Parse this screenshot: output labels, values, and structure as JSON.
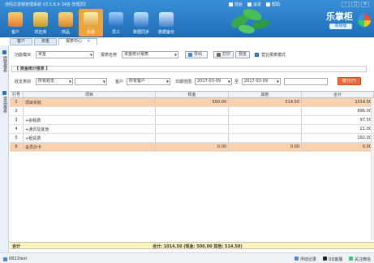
{
  "app": {
    "title": "佳码达进销管理系统 V2.5.8.9【4店-管理员】",
    "topbar": [
      "前台",
      "设定",
      "帮助"
    ],
    "brand": "乐掌柜",
    "brand_sub": "高级版"
  },
  "nav": [
    {
      "label": "客户"
    },
    {
      "label": "供应商"
    },
    {
      "label": "商品"
    },
    {
      "label": "资金"
    },
    {
      "label": "员工"
    },
    {
      "label": "数据同步"
    },
    {
      "label": "数据备份"
    }
  ],
  "tabs": [
    {
      "label": "客户"
    },
    {
      "label": "资金"
    },
    {
      "label": "报表中心",
      "active": true
    }
  ],
  "left_rail": [
    "经营报表",
    "常用报表"
  ],
  "form": {
    "module_label": "功能模块",
    "module_value": "资金",
    "report_label": "报表名称",
    "report_value": "资金统计报表",
    "export_label": "导出",
    "print_label": "打印",
    "preview_label": "预览",
    "business_mode_label": "营业报表模式",
    "section_title": "【 资金统计报表 】",
    "type_label": "收支类别",
    "type_value": "所有收支",
    "customer_label": "客户",
    "customer_value": "所有客户",
    "date_label": "日期范围",
    "date_from": "2017-03-09",
    "date_sep": "至",
    "date_to": "2017-03-09",
    "count_button": "统计(F)"
  },
  "table": {
    "headers": [
      "行号",
      "项目",
      "现金",
      "其他",
      "合计"
    ],
    "rows": [
      {
        "no": "1",
        "project": "项目实收",
        "cash": "500.00",
        "other": "514.50",
        "total": "1014.50",
        "hl": true
      },
      {
        "no": "2",
        "project": "",
        "cash": "",
        "other": "",
        "total": "896.00"
      },
      {
        "no": "3",
        "project": "+杂税费",
        "cash": "",
        "other": "",
        "total": "97.50"
      },
      {
        "no": "4",
        "project": "+通讯及其他",
        "cash": "",
        "other": "",
        "total": "21.00"
      },
      {
        "no": "5",
        "project": "+租赁费",
        "cash": "",
        "other": "",
        "total": "192.00"
      },
      {
        "no": "6",
        "project": "会员办卡",
        "cash": "0.00",
        "other": "0.00",
        "total": "0.00",
        "hl": true
      }
    ]
  },
  "totals": {
    "label": "合计",
    "value": "合计: 1014.50  (现金: 500.00  其他: 514.50)"
  },
  "status": {
    "user": "0822test",
    "items": [
      "浮动记录",
      "QQ客服",
      "关注微信"
    ]
  }
}
